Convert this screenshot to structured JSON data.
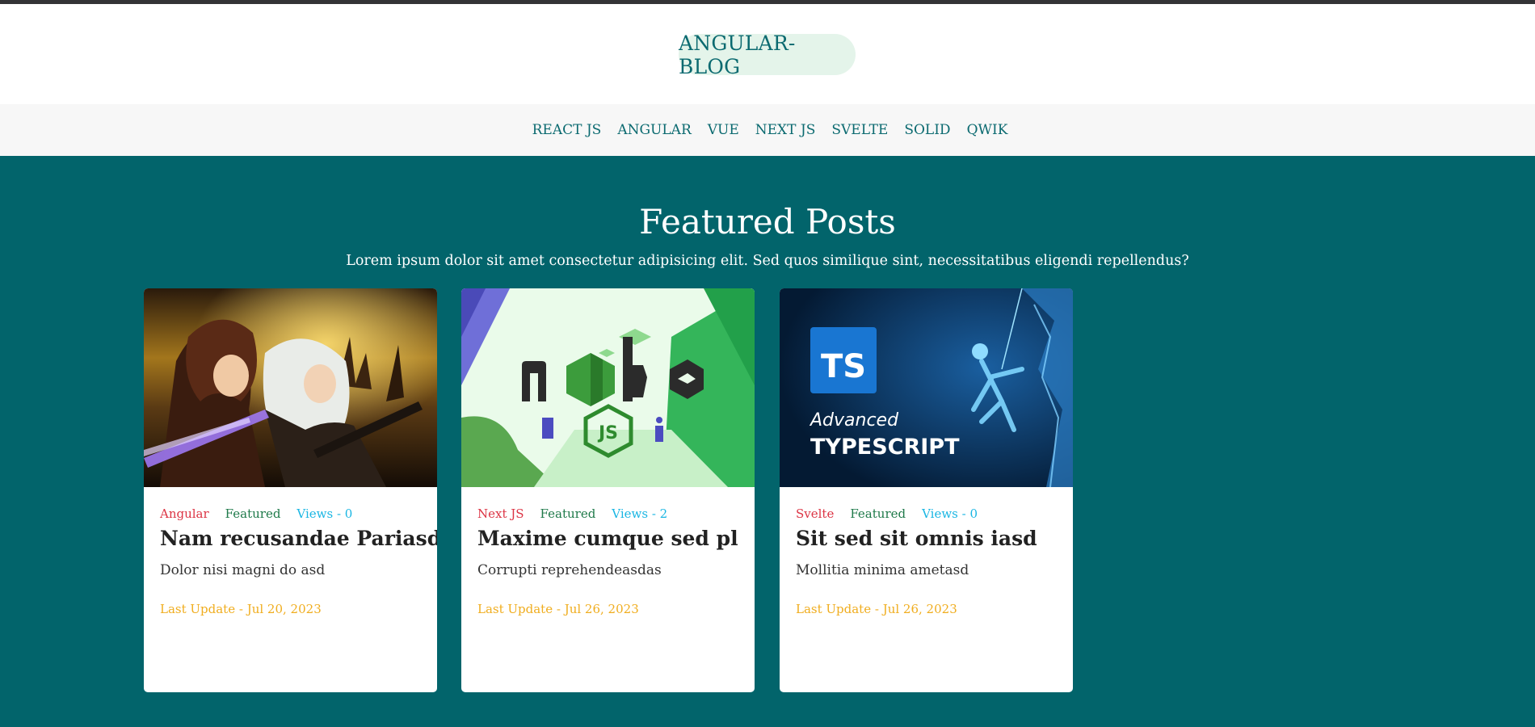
{
  "site": {
    "brand": "ANGULAR-BLOG"
  },
  "nav": {
    "items": [
      {
        "label": "REACT JS"
      },
      {
        "label": "ANGULAR"
      },
      {
        "label": "VUE"
      },
      {
        "label": "NEXT JS"
      },
      {
        "label": "SVELTE"
      },
      {
        "label": "SOLID"
      },
      {
        "label": "QWIK"
      }
    ]
  },
  "hero": {
    "title": "Featured Posts",
    "subtitle": "Lorem ipsum dolor sit amet consectetur adipisicing elit. Sed quos similique sint, necessitatibus eligendi repellendus?"
  },
  "posts": [
    {
      "category": "Angular",
      "featured": "Featured",
      "views": "Views - 0",
      "title": "Nam recusandae Pariasd",
      "description": "Dolor nisi magni do asd",
      "last_update": "Last Update - Jul 20, 2023",
      "image": "anime-artwork"
    },
    {
      "category": "Next JS",
      "featured": "Featured",
      "views": "Views - 2",
      "title": "Maxime cumque sed pl",
      "description": "Corrupti reprehendeasdas",
      "last_update": "Last Update - Jul 26, 2023",
      "image": "nodejs-logo-illustration",
      "image_text": {
        "logo": "node",
        "badge": "JS"
      }
    },
    {
      "category": "Svelte",
      "featured": "Featured",
      "views": "Views - 0",
      "title": "Sit sed sit omnis iasd",
      "description": "Mollitia minima ametasd",
      "last_update": "Last Update - Jul 26, 2023",
      "image": "typescript-climber-illustration",
      "image_text": {
        "badge": "TS",
        "line1": "Advanced",
        "line2": "TYPESCRIPT"
      }
    }
  ],
  "colors": {
    "teal_background": "#02646b",
    "brand_text": "#0b6a70",
    "brand_pill": "#e4f4ea",
    "category": "#dc3545",
    "featured": "#1f7a4a",
    "views": "#1ab6e3",
    "last_update": "#f0ad1e"
  }
}
